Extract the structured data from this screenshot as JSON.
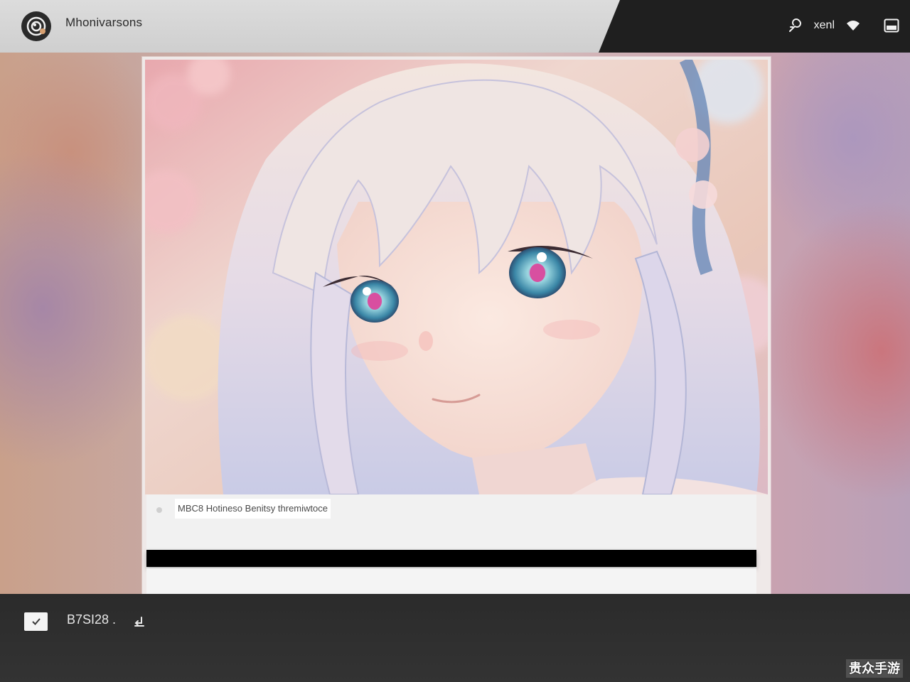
{
  "header": {
    "app_title": "Mhonivarsons",
    "status_label": "xenl",
    "icons": [
      "camera-logo-icon",
      "link-icon",
      "wifi-icon",
      "window-icon"
    ]
  },
  "viewer": {
    "artwork_description_icon": "anime-portrait-image",
    "caption": "MBC8 Hotineso Benitsy thremiwtoce"
  },
  "footer": {
    "selection_count": "B7SI28 .",
    "icons": [
      "check-icon",
      "undo-icon"
    ],
    "watermark": "贵众手游"
  },
  "colors": {
    "topbar_light": "#d6d6d6",
    "topbar_dark": "#1f1f1f",
    "bottombar": "#2f2f2f",
    "caption_bar": "#000000"
  }
}
